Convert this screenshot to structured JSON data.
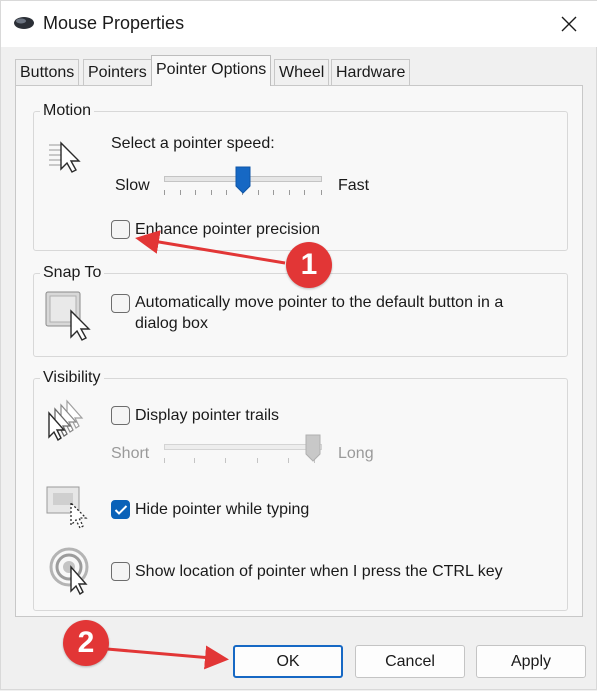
{
  "window": {
    "title": "Mouse Properties",
    "title_icon": "mouse-icon",
    "close_icon": "close-icon"
  },
  "tabs": [
    {
      "label": "Buttons",
      "active": false
    },
    {
      "label": "Pointers",
      "active": false
    },
    {
      "label": "Pointer Options",
      "active": true
    },
    {
      "label": "Wheel",
      "active": false
    },
    {
      "label": "Hardware",
      "active": false
    }
  ],
  "motion": {
    "group_title": "Motion",
    "speed_label": "Select a pointer speed:",
    "slow_label": "Slow",
    "fast_label": "Fast",
    "speed_value": 0.5,
    "enhance_label": "Enhance pointer precision",
    "enhance_checked": false
  },
  "snap_to": {
    "group_title": "Snap To",
    "auto_move_label_line1": "Automatically move pointer to the default button in a",
    "auto_move_label_line2": "dialog box",
    "auto_move_checked": false
  },
  "visibility": {
    "group_title": "Visibility",
    "trails_label": "Display pointer trails",
    "trails_checked": false,
    "short_label": "Short",
    "long_label": "Long",
    "trails_value": 1.0,
    "hide_label": "Hide pointer while typing",
    "hide_checked": true,
    "show_location_label": "Show location of pointer when I press the CTRL key",
    "show_location_checked": false
  },
  "buttons": {
    "ok": "OK",
    "cancel": "Cancel",
    "apply": "Apply"
  },
  "annotations": {
    "badge1": "1",
    "badge2": "2",
    "color": "#e23636"
  },
  "colors": {
    "accent": "#0a62b8",
    "slider_thumb": "#1668c4"
  }
}
